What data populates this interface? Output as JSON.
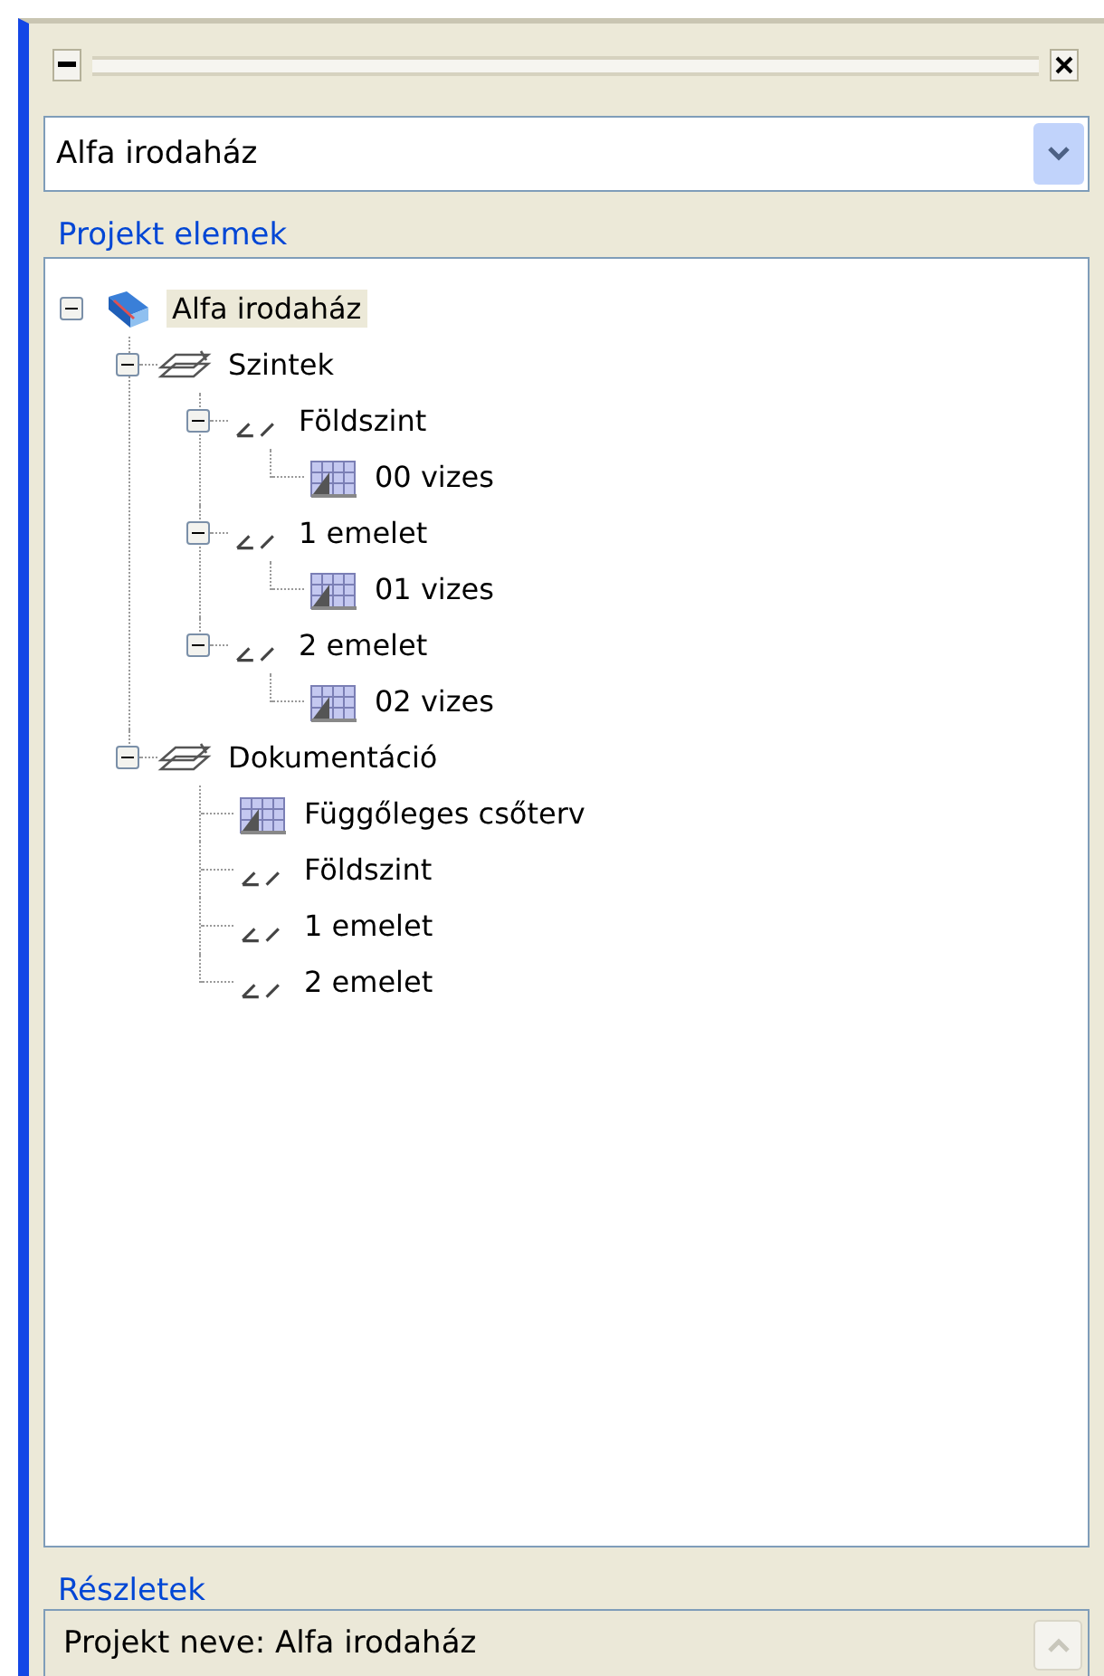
{
  "project_selector": {
    "value": "Alfa irodaház"
  },
  "tree_group": {
    "title": "Projekt elemek",
    "items": [
      {
        "kind": "project",
        "label": "Alfa irodaház",
        "selected": true,
        "expanded": true,
        "children": [
          {
            "kind": "folder",
            "label": "Szintek",
            "selected": false,
            "expanded": true,
            "children": [
              {
                "kind": "level",
                "label": "Földszint",
                "selected": false,
                "expanded": true,
                "children": [
                  {
                    "kind": "view",
                    "label": "00 vizes",
                    "selected": false
                  }
                ]
              },
              {
                "kind": "level",
                "label": "1 emelet",
                "selected": false,
                "expanded": true,
                "children": [
                  {
                    "kind": "view",
                    "label": "01 vizes",
                    "selected": false
                  }
                ]
              },
              {
                "kind": "level",
                "label": "2 emelet",
                "selected": false,
                "expanded": true,
                "children": [
                  {
                    "kind": "view",
                    "label": "02 vizes",
                    "selected": false
                  }
                ]
              }
            ]
          },
          {
            "kind": "folder",
            "label": "Dokumentáció",
            "selected": false,
            "expanded": true,
            "children": [
              {
                "kind": "view",
                "label": "Függőleges csőterv",
                "selected": false
              },
              {
                "kind": "level",
                "label": "Földszint",
                "selected": false
              },
              {
                "kind": "level",
                "label": "1 emelet",
                "selected": false
              },
              {
                "kind": "level",
                "label": "2 emelet",
                "selected": false
              }
            ]
          }
        ]
      }
    ]
  },
  "details_group": {
    "title": "Részletek",
    "text": "Projekt neve: Alfa irodaház"
  }
}
